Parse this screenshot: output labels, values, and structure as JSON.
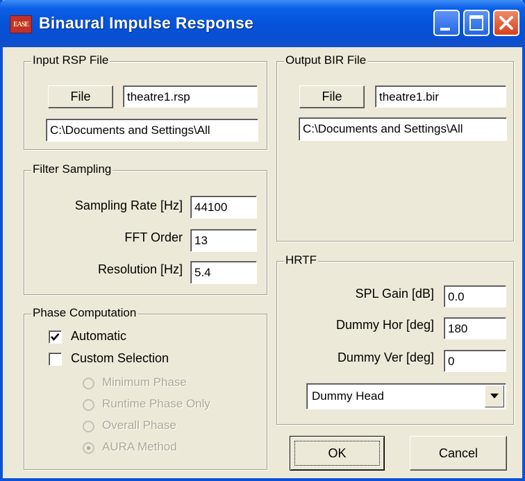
{
  "window": {
    "title": "Binaural Impulse Response",
    "icon_text": "EASE"
  },
  "input_rsp": {
    "legend": "Input RSP File",
    "file_button": "File",
    "file_name": "theatre1.rsp",
    "path": "C:\\Documents and Settings\\All"
  },
  "output_bir": {
    "legend": "Output BIR File",
    "file_button": "File",
    "file_name": "theatre1.bir",
    "path": "C:\\Documents and Settings\\All"
  },
  "filter_sampling": {
    "legend": "Filter Sampling",
    "sampling_rate_label": "Sampling Rate [Hz]",
    "sampling_rate_value": "44100",
    "fft_order_label": "FFT Order",
    "fft_order_value": "13",
    "resolution_label": "Resolution [Hz]",
    "resolution_value": "5.4"
  },
  "phase": {
    "legend": "Phase Computation",
    "automatic_label": "Automatic",
    "automatic_checked": true,
    "custom_label": "Custom Selection",
    "custom_checked": false,
    "options": [
      "Minimum Phase",
      "Runtime Phase Only",
      "Overall Phase",
      "AURA Method"
    ],
    "selected_option": "AURA Method"
  },
  "hrtf": {
    "legend": "HRTF",
    "spl_gain_label": "SPL Gain [dB]",
    "spl_gain_value": "0.0",
    "dummy_hor_label": "Dummy Hor [deg]",
    "dummy_hor_value": "180",
    "dummy_ver_label": "Dummy Ver [deg]",
    "dummy_ver_value": "0",
    "head_select_value": "Dummy Head"
  },
  "buttons": {
    "ok": "OK",
    "cancel": "Cancel"
  },
  "icons": [
    "app-icon",
    "minimize-icon",
    "maximize-icon",
    "close-icon",
    "checkmark-icon",
    "dropdown-arrow-icon"
  ]
}
